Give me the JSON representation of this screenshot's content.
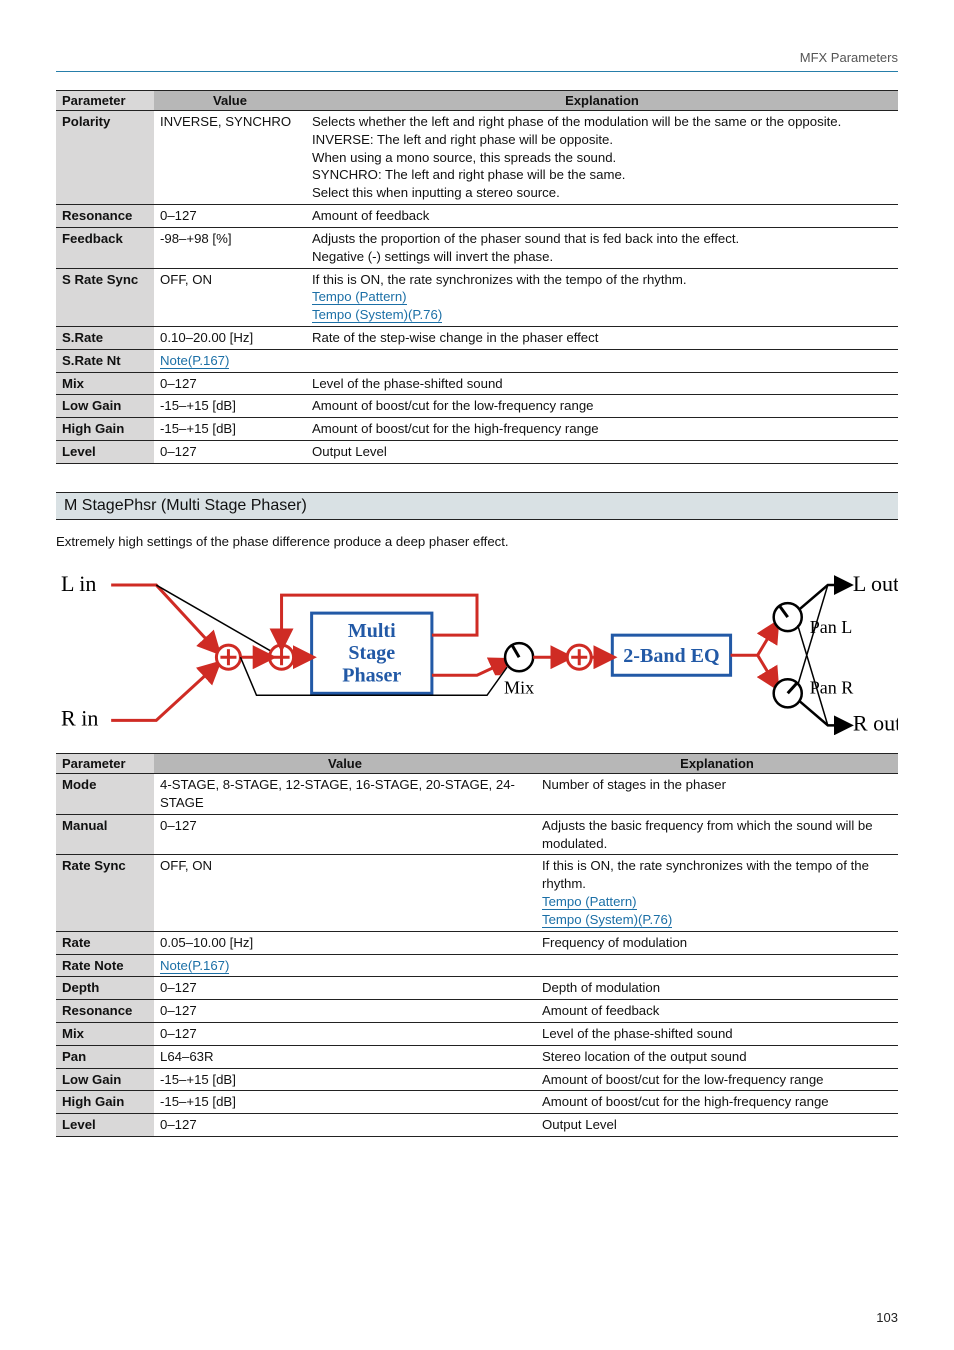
{
  "header": {
    "category": "MFX Parameters"
  },
  "footer": {
    "page": "103"
  },
  "table1": {
    "headers": {
      "param": "Parameter",
      "value": "Value",
      "explanation": "Explanation"
    },
    "rows": {
      "polarity": {
        "name": "Polarity",
        "value": "INVERSE, SYNCHRO",
        "explanation": "Selects whether the left and right phase of the modulation will be the same or the opposite.\nINVERSE: The left and right phase will be opposite.\nWhen using a mono source, this spreads the sound.\nSYNCHRO: The left and right phase will be the same.\nSelect this when inputting a stereo source."
      },
      "resonance": {
        "name": "Resonance",
        "value": "0–127",
        "explanation": "Amount of feedback"
      },
      "feedback": {
        "name": "Feedback",
        "value": "-98–+98 [%]",
        "explanation": "Adjusts the proportion of the phaser sound that is fed back into the effect.\nNegative (-) settings will invert the phase."
      },
      "srate_sync": {
        "name": "S Rate Sync",
        "value": "OFF, ON",
        "exp_line1": "If this is ON, the rate synchronizes with the tempo of the rhythm.",
        "link1": "Tempo (Pattern)",
        "link2": "Tempo (System)(P.76)"
      },
      "srate": {
        "name": "S.Rate",
        "value": "0.10–20.00 [Hz]",
        "explanation": "Rate of the step-wise change in the phaser effect"
      },
      "srate_nt": {
        "name": "S.Rate Nt",
        "value_link": "Note(P.167)",
        "explanation": ""
      },
      "mix": {
        "name": "Mix",
        "value": "0–127",
        "explanation": "Level of the phase-shifted sound"
      },
      "low_gain": {
        "name": "Low Gain",
        "value": "-15–+15 [dB]",
        "explanation": "Amount of boost/cut for the low-frequency range"
      },
      "high_gain": {
        "name": "High Gain",
        "value": "-15–+15 [dB]",
        "explanation": "Amount of boost/cut for the high-frequency range"
      },
      "level": {
        "name": "Level",
        "value": "0–127",
        "explanation": "Output Level"
      }
    }
  },
  "section": {
    "title": "M StagePhsr (Multi Stage Phaser)",
    "body": "Extremely high settings of the phase difference produce a deep phaser effect."
  },
  "diagram": {
    "l_in": "L in",
    "r_in": "R in",
    "box1_l1": "Multi",
    "box1_l2": "Stage",
    "box1_l3": "Phaser",
    "mix": "Mix",
    "box2": "2-Band EQ",
    "pan_l": "Pan L",
    "pan_r": "Pan R",
    "l_out": "L out",
    "r_out": "R out"
  },
  "table2": {
    "headers": {
      "param": "Parameter",
      "value": "Value",
      "explanation": "Explanation"
    },
    "rows": {
      "mode": {
        "name": "Mode",
        "value": "4-STAGE, 8-STAGE, 12-STAGE, 16-STAGE, 20-STAGE, 24-STAGE",
        "explanation": "Number of stages in the phaser"
      },
      "manual": {
        "name": "Manual",
        "value": "0–127",
        "explanation": "Adjusts the basic frequency from which the sound will be modulated."
      },
      "rate_sync": {
        "name": "Rate Sync",
        "value": "OFF, ON",
        "exp_line1": "If this is ON, the rate synchronizes with the tempo of the rhythm.",
        "link1": "Tempo (Pattern)",
        "link2": "Tempo (System)(P.76)"
      },
      "rate": {
        "name": "Rate",
        "value": "0.05–10.00 [Hz]",
        "explanation": "Frequency of modulation"
      },
      "rate_note": {
        "name": "Rate Note",
        "value_link": "Note(P.167)",
        "explanation": ""
      },
      "depth": {
        "name": "Depth",
        "value": "0–127",
        "explanation": "Depth of modulation"
      },
      "resonance": {
        "name": "Resonance",
        "value": "0–127",
        "explanation": "Amount of feedback"
      },
      "mix": {
        "name": "Mix",
        "value": "0–127",
        "explanation": "Level of the phase-shifted sound"
      },
      "pan": {
        "name": "Pan",
        "value": "L64–63R",
        "explanation": "Stereo location of the output sound"
      },
      "low_gain": {
        "name": "Low Gain",
        "value": "-15–+15 [dB]",
        "explanation": "Amount of boost/cut for the low-frequency range"
      },
      "high_gain": {
        "name": "High Gain",
        "value": "-15–+15 [dB]",
        "explanation": "Amount of boost/cut for the high-frequency range"
      },
      "level": {
        "name": "Level",
        "value": "0–127",
        "explanation": "Output Level"
      }
    }
  }
}
